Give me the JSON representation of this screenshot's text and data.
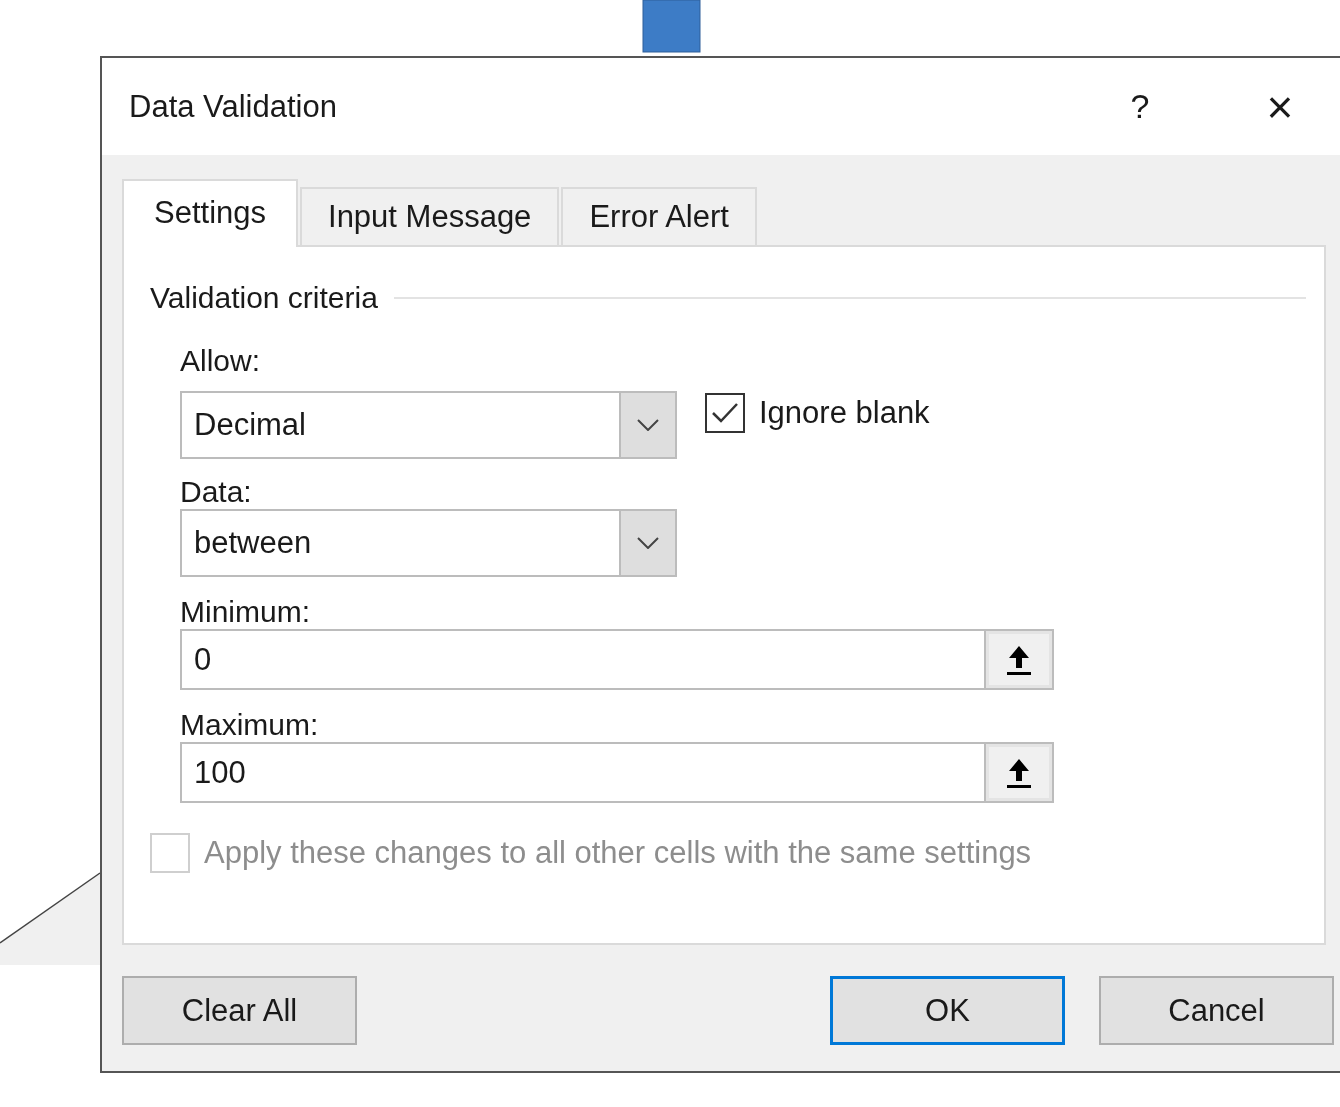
{
  "window": {
    "title": "Data Validation",
    "help": "?",
    "close": "×"
  },
  "tabs": [
    {
      "label": "Settings",
      "selected": true
    },
    {
      "label": "Input Message",
      "selected": false
    },
    {
      "label": "Error Alert",
      "selected": false
    }
  ],
  "criteria": {
    "heading": "Validation criteria",
    "allow": {
      "label": "Allow:",
      "value": "Decimal"
    },
    "ignore_blank": {
      "label": "Ignore blank",
      "checked": true,
      "disabled": false
    },
    "data": {
      "label": "Data:",
      "value": "between"
    },
    "minimum": {
      "label": "Minimum:",
      "value": "0"
    },
    "maximum": {
      "label": "Maximum:",
      "value": "100"
    }
  },
  "apply_to_all": {
    "label": "Apply these changes to all other cells with the same settings",
    "checked": false,
    "disabled": true
  },
  "buttons": [
    {
      "label": "Clear All",
      "default": false
    },
    {
      "label": "OK",
      "default": true
    },
    {
      "label": "Cancel",
      "default": false
    }
  ]
}
